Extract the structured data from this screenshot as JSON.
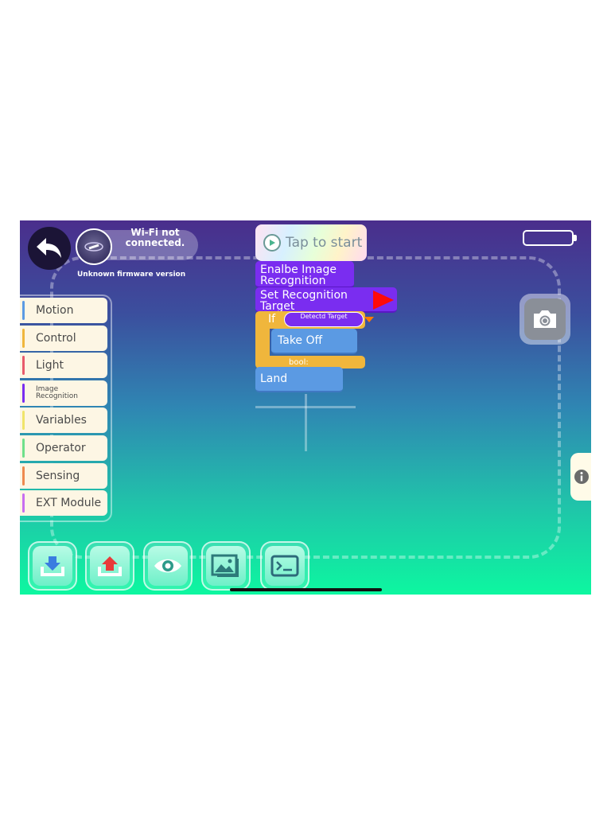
{
  "header": {
    "wifi_status": "Wi-Fi not connected.",
    "firmware": "Unknown firmware version",
    "tap_to_start": "Tap to start"
  },
  "categories": [
    {
      "label": "Motion",
      "color": "#5b9ae3"
    },
    {
      "label": "Control",
      "color": "#f0b63c"
    },
    {
      "label": "Light",
      "color": "#e85a6b"
    },
    {
      "label": "Image Recognition",
      "color": "#7a2df0"
    },
    {
      "label": "Variables",
      "color": "#f0e46a"
    },
    {
      "label": "Operator",
      "color": "#6fe08a"
    },
    {
      "label": "Sensing",
      "color": "#ee8a4e"
    },
    {
      "label": "EXT Module",
      "color": "#c86ef0"
    }
  ],
  "blocks": {
    "enable": "Enalbe Image Recognition",
    "set_target": "Set Recognition Target",
    "if_label": "If",
    "detect_target": "Detectd Target",
    "take_off": "Take Off",
    "bool_label": "bool:",
    "land": "Land"
  },
  "toolbar": [
    {
      "icon": "download-icon"
    },
    {
      "icon": "upload-icon"
    },
    {
      "icon": "eye-icon"
    },
    {
      "icon": "image-icon"
    },
    {
      "icon": "terminal-icon"
    }
  ],
  "colors": {
    "purple_block": "#7a2df0",
    "blue_block": "#5b9ae3",
    "yellow_block": "#f0b63c"
  }
}
